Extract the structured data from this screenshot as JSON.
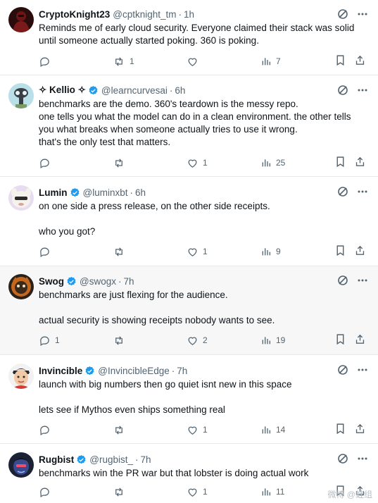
{
  "tweets": [
    {
      "name": "CryptoKnight23",
      "verified": false,
      "handle": "@cptknight_tm",
      "time": "1h",
      "lines": [
        "Reminds me of early cloud security. Everyone claimed their stack was solid",
        "until someone actually started poking. 360 is poking."
      ],
      "replies": "",
      "reposts": "1",
      "likes": "",
      "views": "7"
    },
    {
      "name": "✧ Kellio ✧",
      "verified": true,
      "handle": "@learncurvesai",
      "time": "6h",
      "lines": [
        "benchmarks are the demo. 360's teardown is the messy repo.",
        "one tells you what the model can do in a clean environment. the other tells",
        "you what breaks when someone actually tries to use it wrong.",
        "that's the only test that matters."
      ],
      "replies": "",
      "reposts": "",
      "likes": "1",
      "views": "25"
    },
    {
      "name": "Lumin",
      "verified": true,
      "handle": "@luminxbt",
      "time": "6h",
      "lines": [
        "on one side a press release, on the other side receipts.",
        "",
        "who you got?"
      ],
      "replies": "",
      "reposts": "",
      "likes": "1",
      "views": "9"
    },
    {
      "name": "Swog",
      "verified": true,
      "handle": "@swogx",
      "time": "7h",
      "lines": [
        "benchmarks are just flexing for the audience.",
        "",
        "actual security is showing receipts nobody wants to see."
      ],
      "replies": "1",
      "reposts": "",
      "likes": "2",
      "views": "19"
    },
    {
      "name": "Invincible",
      "verified": true,
      "handle": "@InvincibleEdge",
      "time": "7h",
      "lines": [
        "launch with big numbers then go quiet isnt new in this space",
        "",
        "lets see if Mythos even ships something real"
      ],
      "replies": "",
      "reposts": "",
      "likes": "1",
      "views": "14"
    },
    {
      "name": "Rugbist",
      "verified": true,
      "handle": "@rugbist_",
      "time": "7h",
      "lines": [
        "benchmarks win the PR war but that lobster is doing actual work"
      ],
      "replies": "",
      "reposts": "",
      "likes": "1",
      "views": "11"
    }
  ],
  "separator": "·",
  "watermark": "微博 @蛙组",
  "icons": {
    "reply": "reply-icon",
    "repost": "repost-icon",
    "like": "like-icon",
    "views": "views-icon",
    "bookmark": "bookmark-icon",
    "share": "share-icon",
    "grok": "grok-icon",
    "more": "more-icon",
    "verified": "verified-badge-icon"
  },
  "colors": {
    "text": "#0f1419",
    "muted": "#536471",
    "verified": "#1d9bf0",
    "border": "#e7e9ea",
    "hover_bg": "#f7f7f7"
  }
}
